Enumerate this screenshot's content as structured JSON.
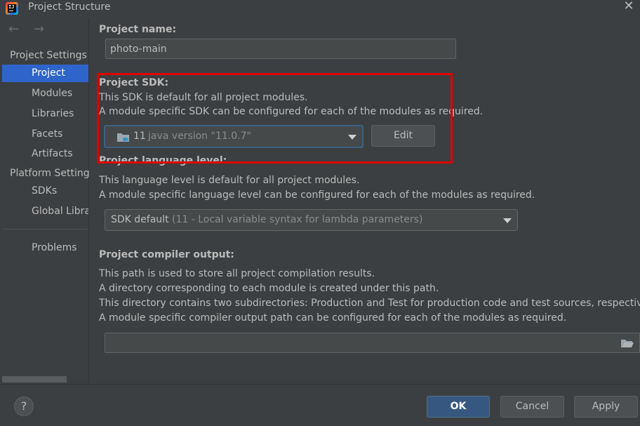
{
  "window": {
    "title": "Project Structure",
    "app_icon_text": "IJ",
    "close_glyph": "✕"
  },
  "nav": {
    "back_glyph": "←",
    "forward_glyph": "→"
  },
  "sidebar": {
    "project_settings_header": "Project Settings",
    "platform_settings_header": "Platform Setting",
    "items": [
      {
        "label": "Project",
        "selected": true
      },
      {
        "label": "Modules"
      },
      {
        "label": "Libraries"
      },
      {
        "label": "Facets"
      },
      {
        "label": "Artifacts"
      }
    ],
    "platform_items": [
      {
        "label": "SDKs"
      },
      {
        "label": "Global Libra"
      }
    ],
    "problems": "Problems"
  },
  "project_name": {
    "label": "Project name:",
    "value": "photo-main"
  },
  "project_sdk": {
    "label": "Project SDK:",
    "line1": "This SDK is default for all project modules.",
    "line2": "A module specific SDK can be configured for each of the modules as required.",
    "selected_version": "11",
    "selected_detail": "java version \"11.0.7\"",
    "edit_label": "Edit"
  },
  "language_level": {
    "label": "Project language level:",
    "line1": "This language level is default for all project modules.",
    "line2": "A module specific language level can be configured for each of the modules as required.",
    "selected": "SDK default",
    "selected_detail": "(11 - Local variable syntax for lambda parameters)"
  },
  "compiler_output": {
    "label": "Project compiler output:",
    "line1": "This path is used to store all project compilation results.",
    "line2": "A directory corresponding to each module is created under this path.",
    "line3": "This directory contains two subdirectories: Production and Test for production code and test sources, respectively.",
    "line4": "A module specific compiler output path can be configured for each of the modules as required.",
    "value": ""
  },
  "footer": {
    "help_glyph": "?",
    "ok_label": "OK",
    "cancel_label": "Cancel",
    "apply_label": "Apply"
  },
  "colors": {
    "background": "#3c3f41",
    "selection": "#2f65ca",
    "primary_button": "#365880",
    "annotation_box": "#e00000"
  }
}
